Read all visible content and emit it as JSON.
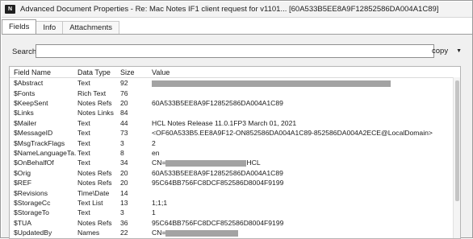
{
  "window": {
    "title": "Advanced Document Properties - Re: Mac Notes IF1 client request for v1101... [60A533B5EE8A9F12852586DA004A1C89]",
    "icon_label": "N"
  },
  "tabs": [
    {
      "label": "Fields",
      "active": true
    },
    {
      "label": "Info",
      "active": false
    },
    {
      "label": "Attachments",
      "active": false
    }
  ],
  "search": {
    "label": "Search:",
    "value": "",
    "placeholder": ""
  },
  "copy": {
    "label": "copy",
    "caret": "▼"
  },
  "table": {
    "columns": [
      "Field Name",
      "Data Type",
      "Size",
      "Value"
    ],
    "rows": [
      {
        "name": "$Abstract",
        "type": "Text",
        "size": "92",
        "value": "",
        "redacted": true,
        "redact_after": ""
      },
      {
        "name": "$Fonts",
        "type": "Rich Text",
        "size": "76",
        "value": "",
        "redacted": false
      },
      {
        "name": "$KeepSent",
        "type": "Notes Refs",
        "size": "20",
        "value": "60A533B5EE8A9F12852586DA004A1C89",
        "redacted": false
      },
      {
        "name": "$Links",
        "type": "Notes Links",
        "size": "84",
        "value": "",
        "redacted": false
      },
      {
        "name": "$Mailer",
        "type": "Text",
        "size": "44",
        "value": "HCL Notes Release 11.0.1FP3 March 01, 2021",
        "redacted": false
      },
      {
        "name": "$MessageID",
        "type": "Text",
        "size": "73",
        "value": "<OF60A533B5.EE8A9F12-ON852586DA004A1C89-852586DA004A2ECE@LocalDomain>",
        "redacted": false
      },
      {
        "name": "$MsgTrackFlags",
        "type": "Text",
        "size": "3",
        "value": "2",
        "redacted": false
      },
      {
        "name": "$NameLanguageTa...",
        "type": "Text",
        "size": "8",
        "value": "en",
        "redacted": false
      },
      {
        "name": "$OnBehalfOf",
        "type": "Text",
        "size": "34",
        "value": "CN=",
        "redacted": true,
        "redact_after": "HCL"
      },
      {
        "name": "$Orig",
        "type": "Notes Refs",
        "size": "20",
        "value": "60A533B5EE8A9F12852586DA004A1C89",
        "redacted": false
      },
      {
        "name": "$REF",
        "type": "Notes Refs",
        "size": "20",
        "value": "95C64BB756FC8DCF852586D8004F9199",
        "redacted": false
      },
      {
        "name": "$Revisions",
        "type": "Time\\Date",
        "size": "14",
        "value": "",
        "redacted": false
      },
      {
        "name": "$StorageCc",
        "type": "Text List",
        "size": "13",
        "value": "1;1;1",
        "redacted": false
      },
      {
        "name": "$StorageTo",
        "type": "Text",
        "size": "3",
        "value": "1",
        "redacted": false
      },
      {
        "name": "$TUA",
        "type": "Notes Refs",
        "size": "36",
        "value": "95C64BB756FC8DCF852586D8004F9199",
        "redacted": false
      },
      {
        "name": "$UpdatedBy",
        "type": "Names",
        "size": "22",
        "value": "CN=",
        "redacted": true,
        "redact_after": ""
      }
    ]
  },
  "colors": {
    "panel": "#f0f0f0",
    "redaction": "#a3a3a3",
    "active_tab_border": "#9c9c9c"
  }
}
